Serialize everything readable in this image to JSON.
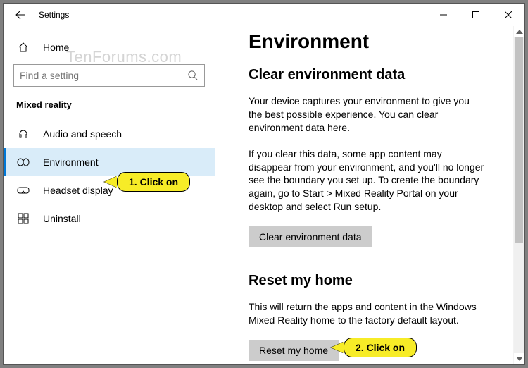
{
  "window": {
    "title": "Settings"
  },
  "sidebar": {
    "home": "Home",
    "search_placeholder": "Find a setting",
    "section": "Mixed reality",
    "items": [
      {
        "label": "Audio and speech"
      },
      {
        "label": "Environment"
      },
      {
        "label": "Headset display"
      },
      {
        "label": "Uninstall"
      }
    ]
  },
  "content": {
    "heading": "Environment",
    "sec1_title": "Clear environment data",
    "sec1_p1": "Your device captures your environment to give you the best possible experience. You can clear environment data here.",
    "sec1_p2": "If you clear this data, some app content may disappear from your environment, and you'll no longer see the boundary you set up. To create the boundary again, go to Start > Mixed Reality Portal on your desktop and select Run setup.",
    "sec1_btn": "Clear environment data",
    "sec2_title": "Reset my home",
    "sec2_p1": "This will return the apps and content in the Windows Mixed Reality home to the factory default layout.",
    "sec2_btn": "Reset my home"
  },
  "annotations": {
    "a1": "1. Click on",
    "a2": "2. Click on"
  },
  "watermark": "TenForums.com"
}
